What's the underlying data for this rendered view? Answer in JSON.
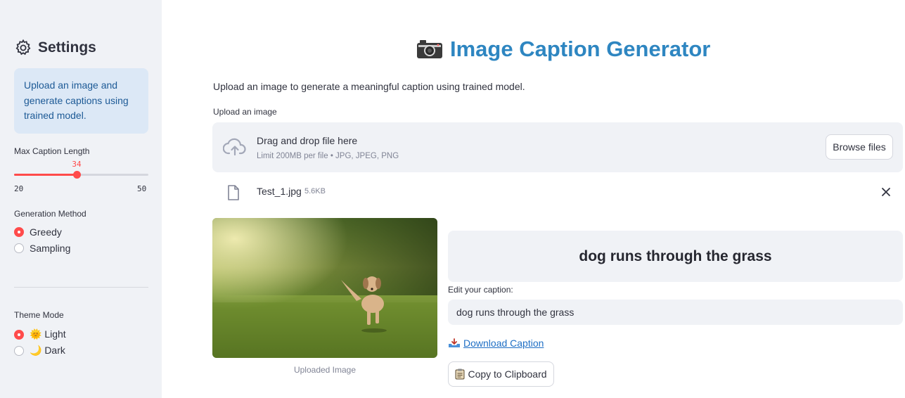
{
  "sidebar": {
    "title": "Settings",
    "info": "Upload an image and generate captions using trained model.",
    "max_len": {
      "label": "Max Caption Length",
      "value": 34,
      "value_text": "34",
      "min": 20,
      "min_text": "20",
      "max": 50,
      "max_text": "50"
    },
    "gen_method": {
      "label": "Generation Method",
      "options": [
        "Greedy",
        "Sampling"
      ],
      "selected": "Greedy"
    },
    "theme": {
      "label": "Theme Mode",
      "options": [
        "🌞 Light",
        "🌙 Dark"
      ],
      "selected": "🌞 Light"
    }
  },
  "main": {
    "title": "Image Caption Generator",
    "subtitle": "Upload an image to generate a meaningful caption using trained model.",
    "uploader": {
      "label": "Upload an image",
      "drop_text": "Drag and drop file here",
      "limit_text": "Limit 200MB per file • JPG, JPEG, PNG",
      "browse": "Browse files"
    },
    "file": {
      "name": "Test_1.jpg",
      "size": "5.6KB"
    },
    "image_caption": "Uploaded Image",
    "generated_caption": "dog runs through the grass",
    "edit_label": "Edit your caption:",
    "edit_value": "dog runs through the grass",
    "download": "Download Caption",
    "copy": "Copy to Clipboard"
  },
  "colors": {
    "accent": "#ff4b4b",
    "title": "#2e86c1",
    "sidebar_bg": "#f0f2f6",
    "info_bg": "#dce8f6",
    "link": "#1f6fc5"
  },
  "icons": [
    "gear-icon",
    "camera-icon",
    "cloud-upload-icon",
    "file-icon",
    "close-icon",
    "inbox-tray-icon",
    "clipboard-icon"
  ]
}
